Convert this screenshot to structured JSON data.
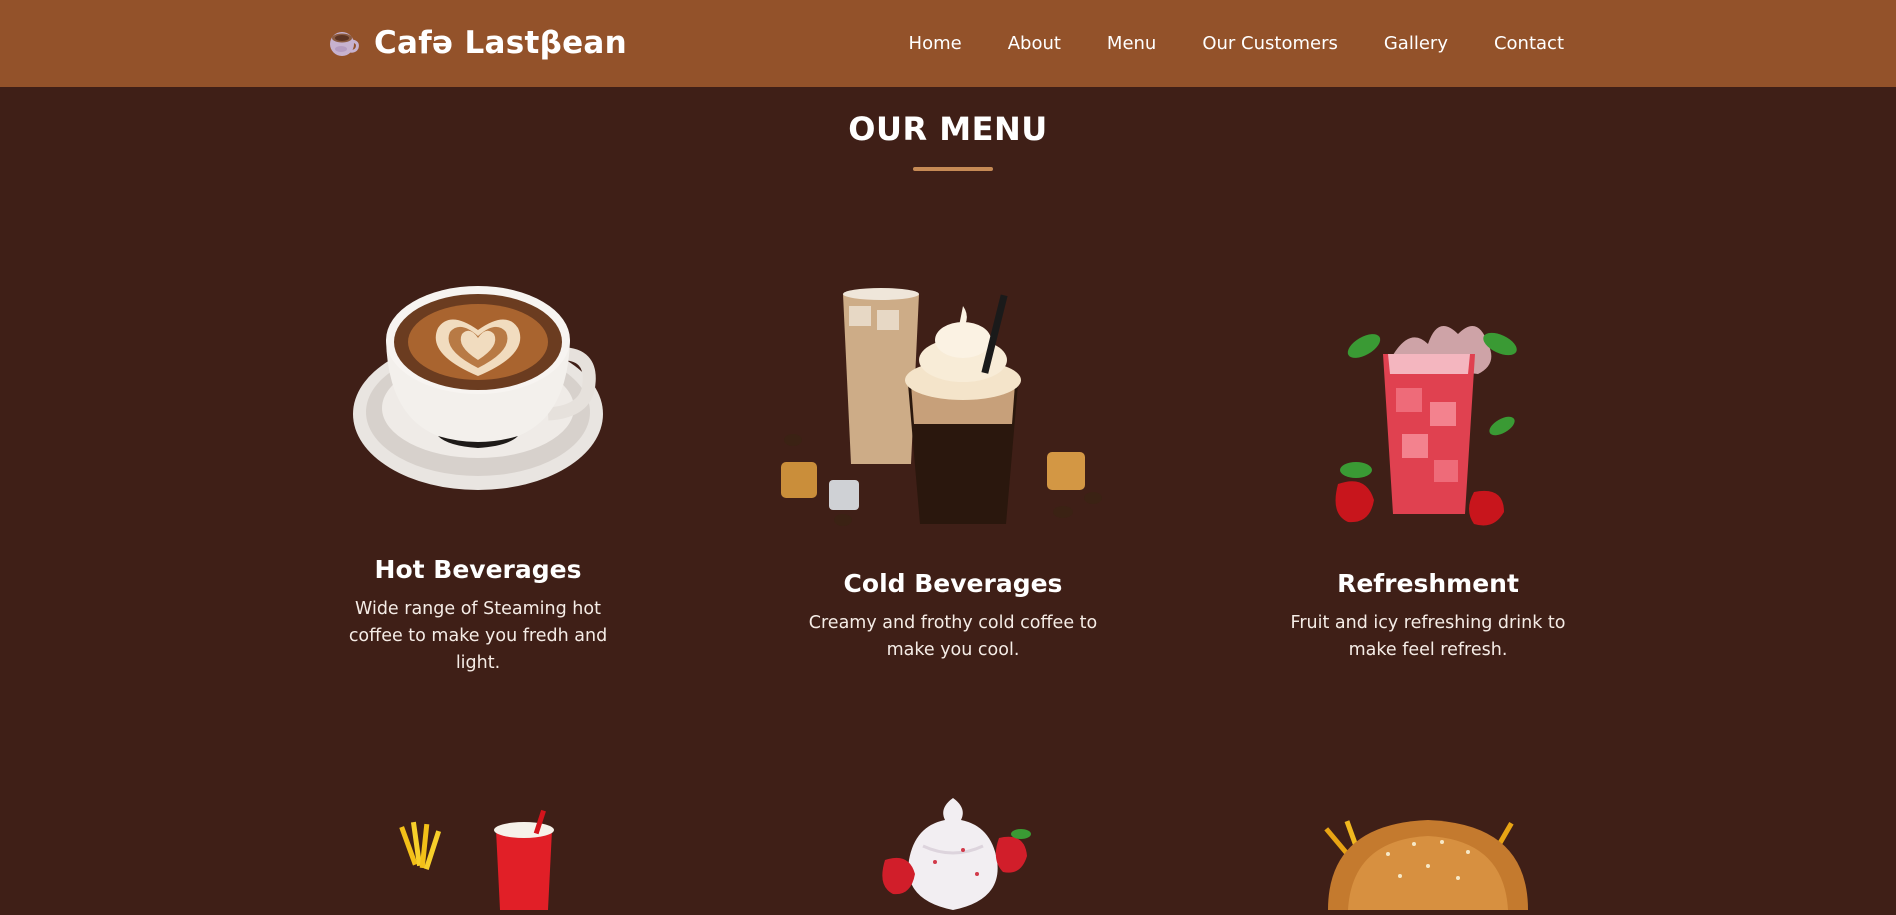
{
  "header": {
    "brand_name": "Cafə Lastβean",
    "brand_icon": "coffee-cup-icon",
    "nav": [
      {
        "label": "Home"
      },
      {
        "label": "About"
      },
      {
        "label": "Menu"
      },
      {
        "label": "Our Customers"
      },
      {
        "label": "Gallery"
      },
      {
        "label": "Contact"
      }
    ]
  },
  "menu_section": {
    "title": "OUR MENU",
    "items": [
      {
        "title": "Hot Beverages",
        "description": "Wide range of Steaming hot coffee to make you fredh and light.",
        "image": "latte-art-cup-image"
      },
      {
        "title": "Cold Beverages",
        "description": "Creamy and frothy cold coffee to make you cool.",
        "image": "iced-coffee-image"
      },
      {
        "title": "Refreshment",
        "description": "Fruit and icy refreshing drink to make feel refresh.",
        "image": "strawberry-drink-image"
      }
    ],
    "next_row_images": [
      "fries-and-soda-image",
      "strawberry-ice-cream-image",
      "burger-image"
    ]
  },
  "colors": {
    "navbar": "#93522a",
    "background": "#3f1f17",
    "accent_underline": "#c68a55",
    "text": "#ffffff"
  }
}
